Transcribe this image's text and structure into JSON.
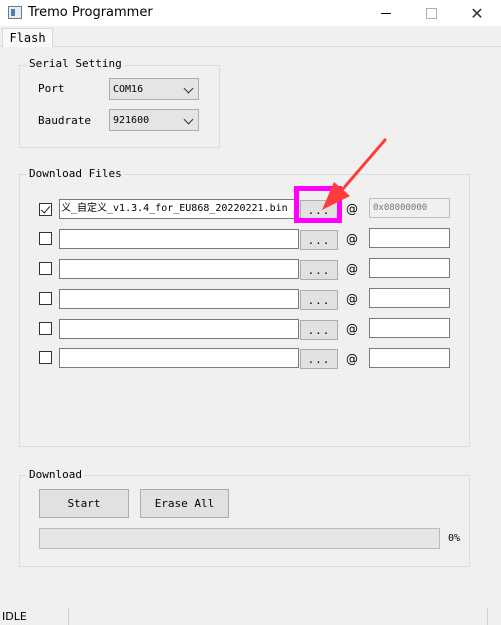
{
  "window": {
    "title": "Tremo Programmer",
    "close_glyph": "✕"
  },
  "tabs": [
    {
      "label": "Flash",
      "active": true
    }
  ],
  "serial_setting": {
    "title": "Serial Setting",
    "port_label": "Port",
    "port_value": "COM16",
    "baudrate_label": "Baudrate",
    "baudrate_value": "921600"
  },
  "download_files": {
    "title": "Download Files",
    "browse_label": "...",
    "at_symbol": "@",
    "rows": [
      {
        "checked": true,
        "file": "义_自定义_v1.3.4_for_EU868_20220221.bin",
        "address": "0x08000000",
        "address_enabled": false
      },
      {
        "checked": false,
        "file": "",
        "address": "",
        "address_enabled": true
      },
      {
        "checked": false,
        "file": "",
        "address": "",
        "address_enabled": true
      },
      {
        "checked": false,
        "file": "",
        "address": "",
        "address_enabled": true
      },
      {
        "checked": false,
        "file": "",
        "address": "",
        "address_enabled": true
      },
      {
        "checked": false,
        "file": "",
        "address": "",
        "address_enabled": true
      }
    ]
  },
  "download": {
    "title": "Download",
    "start_label": "Start",
    "erase_label": "Erase All",
    "progress_text": "0%",
    "progress_value": 0
  },
  "status_bar": {
    "text": "IDLE"
  },
  "annotations": {
    "highlight_color": "#ff00ff",
    "arrow_color": "#ff3b3b"
  }
}
